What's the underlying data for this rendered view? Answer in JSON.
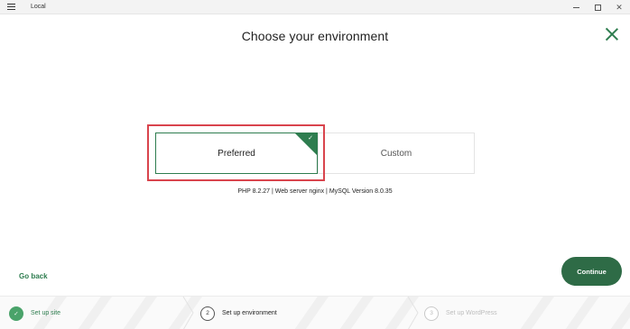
{
  "window": {
    "title": "Local",
    "menu_icon": "hamburger-menu-icon",
    "controls": {
      "minimize_icon": "minimize-icon",
      "maximize_icon": "maximize-icon",
      "close_glyph": "✕"
    }
  },
  "header": {
    "title": "Choose your environment",
    "close_icon": "close-icon"
  },
  "options": {
    "preferred": {
      "label": "Preferred",
      "selected": true,
      "check_icon": "checkmark-icon",
      "check_glyph": "✓"
    },
    "custom": {
      "label": "Custom",
      "selected": false
    }
  },
  "environment_info": "PHP 8.2.27 | Web server nginx | MySQL Version 8.0.35",
  "actions": {
    "back": "Go back",
    "continue": "Continue"
  },
  "steps": [
    {
      "number": "1",
      "label": "Set up site",
      "status": "done",
      "glyph": "✓"
    },
    {
      "number": "2",
      "label": "Set up environment",
      "status": "current"
    },
    {
      "number": "3",
      "label": "Set up WordPress",
      "status": "upcoming"
    }
  ],
  "colors": {
    "accent_green": "#2e7d4f",
    "continue_button": "#2e6b46",
    "step_done": "#4aa36a",
    "highlight_border": "#d9444d"
  }
}
